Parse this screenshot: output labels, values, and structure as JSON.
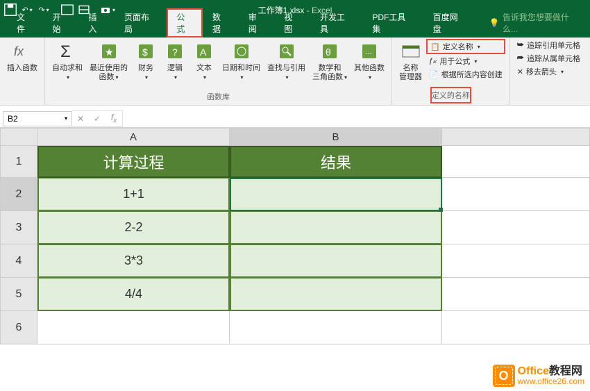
{
  "titlebar": {
    "doc_name": "工作簿1.xlsx",
    "app_name": "Excel"
  },
  "menu": {
    "tabs": [
      "文件",
      "开始",
      "插入",
      "页面布局",
      "公式",
      "数据",
      "审阅",
      "视图",
      "开发工具",
      "PDF工具集",
      "百度网盘"
    ],
    "active": "公式",
    "tell_me": "告诉我您想要做什么..."
  },
  "ribbon": {
    "insert_fn": "插入函数",
    "autosum": "自动求和",
    "recent": "最近使用的\n函数",
    "financial": "财务",
    "logical": "逻辑",
    "text": "文本",
    "datetime": "日期和时间",
    "lookup": "查找与引用",
    "math": "数学和\n三角函数",
    "other": "其他函数",
    "name_mgr": "名称\n管理器",
    "define_name": "定义名称",
    "use_formula": "用于公式",
    "create_from": "根据所选内容创建",
    "trace_prec": "追踪引用单元格",
    "trace_dep": "追踪从属单元格",
    "remove_arrows": "移去箭头",
    "group_lib": "函数库",
    "group_names": "定义的名称"
  },
  "formula_bar": {
    "name_box": "B2",
    "formula": ""
  },
  "grid": {
    "cols": [
      "A",
      "B"
    ],
    "headers": {
      "A": "计算过程",
      "B": "结果"
    },
    "data": [
      {
        "A": "1+1",
        "B": ""
      },
      {
        "A": "2-2",
        "B": ""
      },
      {
        "A": "3*3",
        "B": ""
      },
      {
        "A": "4/4",
        "B": ""
      }
    ],
    "selected": "B2"
  },
  "watermark": {
    "brand": "Office",
    "suffix": "教程网",
    "url": "www.office26.com"
  },
  "chart_data": {
    "type": "table",
    "title": "",
    "columns": [
      "计算过程",
      "结果"
    ],
    "rows": [
      [
        "1+1",
        ""
      ],
      [
        "2-2",
        ""
      ],
      [
        "3*3",
        ""
      ],
      [
        "4/4",
        ""
      ]
    ]
  }
}
